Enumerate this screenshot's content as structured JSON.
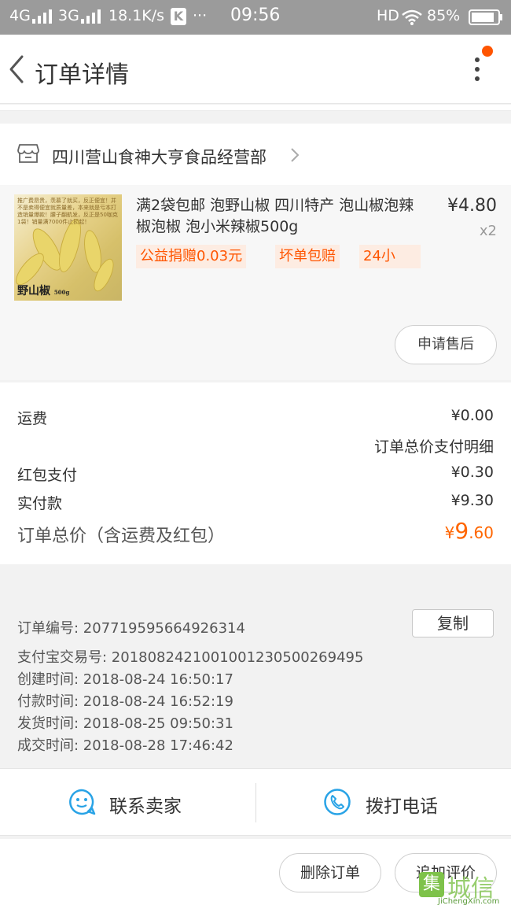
{
  "status_bar": {
    "network_left": "4G",
    "network_right": "3G",
    "speed": "18.1K/s",
    "app_badge": "K",
    "dots": "···",
    "time": "09:56",
    "hd": "HD",
    "battery": "85%"
  },
  "header": {
    "title": "订单详情"
  },
  "shop": {
    "name": "四川营山食神大亨食品经营部"
  },
  "product": {
    "title": "满2袋包邮 泡野山椒 四川特产 泡山椒泡辣椒泡椒 泡小米辣椒500g",
    "price": "¥4.80",
    "quantity": "x2",
    "thumb_caption": "推广费昂贵，羡慕了就买，反正便宜！并不是卖得便宜就质量差，本来就是亏本打造销量爆款！腰子翻航发，反正是50咖克1袋！销量满7000件止损起！",
    "thumb_logo": "野山椒",
    "thumb_logo_sub": "500g",
    "tags": [
      "公益捐赠0.03元",
      "坏单包赔",
      "24小"
    ],
    "after_sale": "申请售后"
  },
  "summary": {
    "shipping_label": "运费",
    "shipping_value": "¥0.00",
    "detail_link": "订单总价支付明细",
    "red_packet_label": "红包支付",
    "red_packet_value": "¥0.30",
    "paid_label": "实付款",
    "paid_value": "¥9.30",
    "total_label": "订单总价（含运费及红包）",
    "total_currency": "¥",
    "total_int": "9",
    "total_dec": ".60"
  },
  "order_info": {
    "order_no": "订单编号:   207719595664926314",
    "copy": "复制",
    "alipay_no": "支付宝交易号:   2018082421001001230500269495",
    "created": "创建时间:   2018-08-24 16:50:17",
    "paid": "付款时间:   2018-08-24 16:52:19",
    "shipped": "发货时间:   2018-08-25 09:50:31",
    "completed": "成交时间:   2018-08-28 17:46:42"
  },
  "contact": {
    "seller": "联系卖家",
    "phone": "拨打电话"
  },
  "actions": {
    "delete": "删除订单",
    "review": "追加评价"
  },
  "watermark": {
    "cn": "城信",
    "box": "集",
    "en": "JiChengXin.com"
  },
  "colors": {
    "accent": "#ff5500",
    "price_orange": "#ff6600",
    "icon_blue": "#29a3e6",
    "status_bar": "#9b9b9b"
  }
}
